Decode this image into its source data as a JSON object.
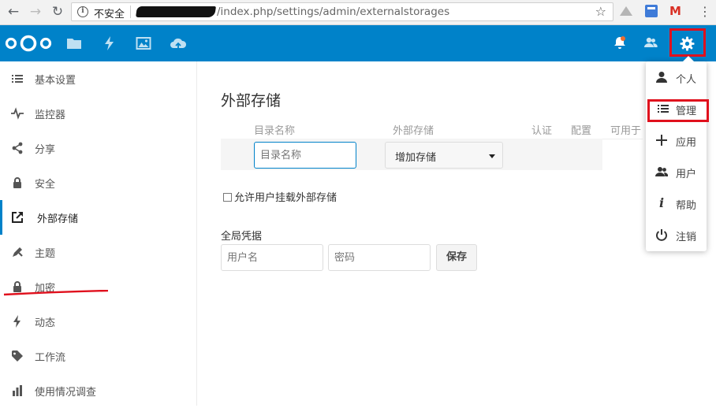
{
  "browser": {
    "security_label": "不安全",
    "url": "/index.php/settings/admin/externalstorages"
  },
  "header": {
    "apps": [
      "files-icon",
      "activity-icon",
      "gallery-icon",
      "cloud-upload-icon"
    ],
    "right_icons": [
      "notifications-icon",
      "contacts-icon",
      "settings-gear-icon"
    ]
  },
  "sidebar": {
    "items": [
      {
        "label": "基本设置",
        "icon": "list-icon"
      },
      {
        "label": "监控器",
        "icon": "pulse-icon"
      },
      {
        "label": "分享",
        "icon": "share-icon"
      },
      {
        "label": "安全",
        "icon": "lock-icon"
      },
      {
        "label": "外部存储",
        "icon": "external-link-icon",
        "active": true
      },
      {
        "label": "主题",
        "icon": "brush-icon"
      },
      {
        "label": "加密",
        "icon": "lock-icon"
      },
      {
        "label": "动态",
        "icon": "lightning-icon"
      },
      {
        "label": "工作流",
        "icon": "tag-icon"
      },
      {
        "label": "使用情况调查",
        "icon": "bar-chart-icon"
      }
    ]
  },
  "main": {
    "title": "外部存储",
    "columns": [
      "目录名称",
      "外部存储",
      "认证",
      "配置",
      "可用于"
    ],
    "dir_placeholder": "目录名称",
    "add_storage": "增加存储",
    "allow_users_label": "允许用户挂载外部存储",
    "global_credentials_label": "全局凭据",
    "username_placeholder": "用户名",
    "password_placeholder": "密码",
    "save_label": "保存"
  },
  "dropdown": {
    "items": [
      {
        "label": "个人",
        "icon": "user-icon"
      },
      {
        "label": "管理",
        "icon": "list-icon",
        "highlighted": true
      },
      {
        "label": "应用",
        "icon": "plus-icon"
      },
      {
        "label": "用户",
        "icon": "users-icon"
      },
      {
        "label": "帮助",
        "icon": "info-icon"
      },
      {
        "label": "注销",
        "icon": "power-icon"
      }
    ]
  },
  "colors": {
    "brand": "#0082c9",
    "annotation_red": "#e0101d"
  }
}
